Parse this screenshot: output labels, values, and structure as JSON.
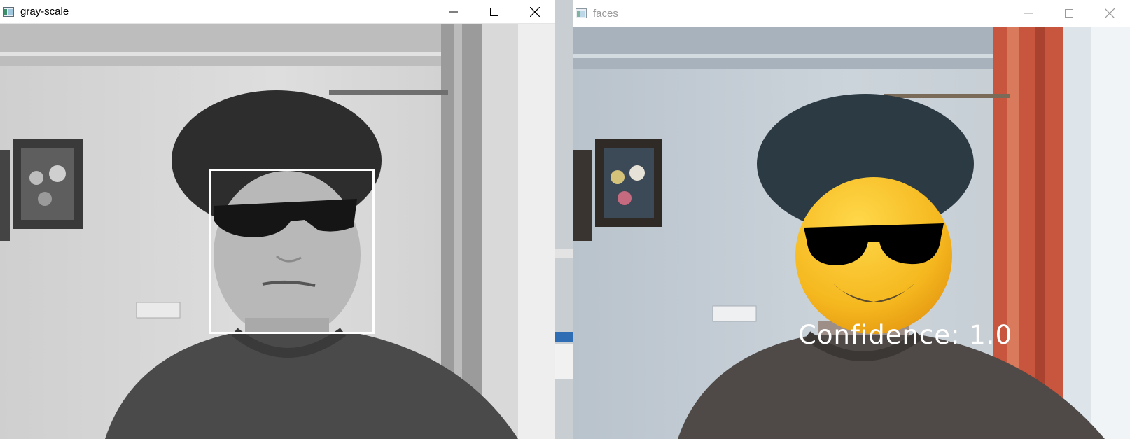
{
  "windows": [
    {
      "id": "gray-scale",
      "title": "gray-scale",
      "icon": "opencv-window-icon",
      "controls": [
        "minimize-icon",
        "maximize-icon",
        "close-icon"
      ],
      "active": true
    },
    {
      "id": "faces",
      "title": "faces",
      "icon": "opencv-window-icon",
      "controls": [
        "minimize-icon",
        "maximize-icon",
        "close-icon"
      ],
      "active": false,
      "overlay_text": "Confidence: 1.0",
      "overlay_emoji": "sunglasses-face-emoji"
    }
  ],
  "colors": {
    "box": "#ffffff",
    "emoji_face": "#f5b81f",
    "emoji_glasses": "#000000",
    "curtain": "#c8553d"
  }
}
